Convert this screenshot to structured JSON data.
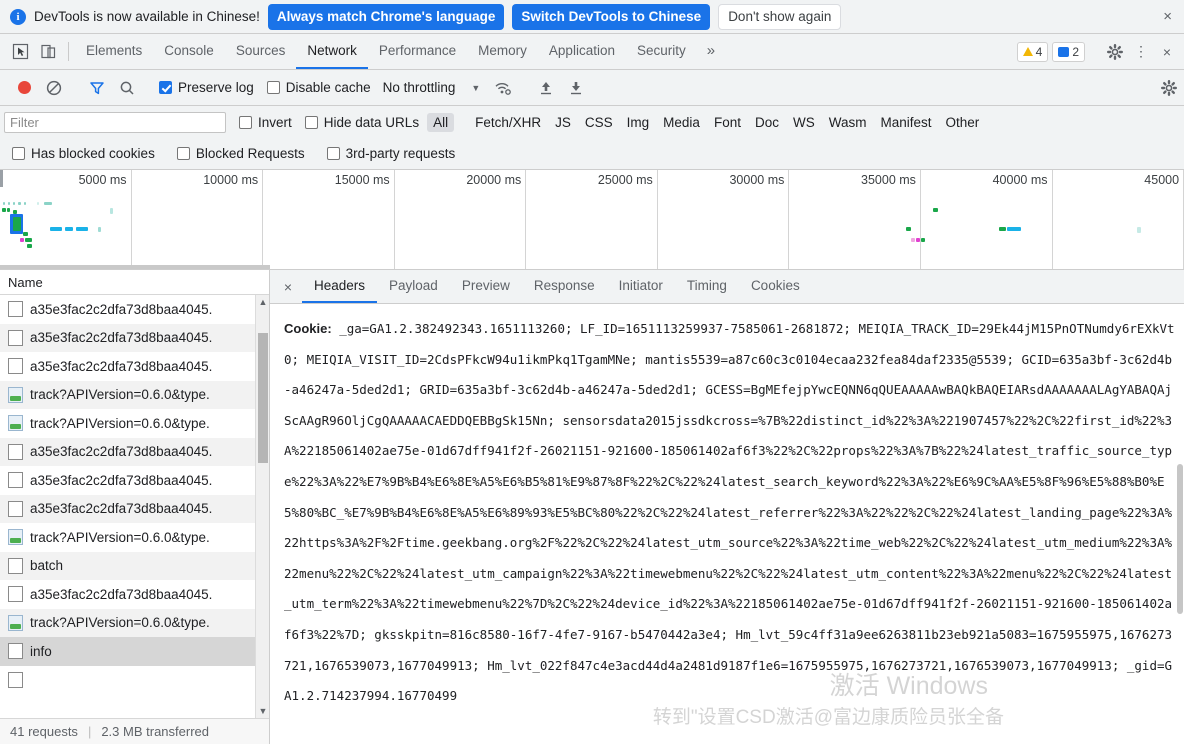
{
  "banner": {
    "icon": "info-icon",
    "message": "DevTools is now available in Chinese!",
    "primary_button": "Always match Chrome's language",
    "secondary_button": "Switch DevTools to Chinese",
    "dismiss_button": "Don't show again",
    "close_icon": "×",
    "accent_color": "#1a73e8"
  },
  "tabbar": {
    "inspect_icon": "inspect-cursor-icon",
    "device_icon": "device-toolbar-icon",
    "tabs": [
      {
        "label": "Elements",
        "active": false
      },
      {
        "label": "Console",
        "active": false
      },
      {
        "label": "Sources",
        "active": false
      },
      {
        "label": "Network",
        "active": true
      },
      {
        "label": "Performance",
        "active": false
      },
      {
        "label": "Memory",
        "active": false
      },
      {
        "label": "Application",
        "active": false
      },
      {
        "label": "Security",
        "active": false
      }
    ],
    "more_tabs_icon": "»",
    "warning_count": "4",
    "message_count": "2",
    "settings_icon": "gear-icon",
    "kebab_icon": "⋮",
    "close_icon": "×"
  },
  "netbar": {
    "record_label": "record-button",
    "clear_label": "clear-button",
    "filter_icon": "funnel-icon",
    "search_icon": "search-icon",
    "preserve_log_label": "Preserve log",
    "preserve_log_checked": true,
    "disable_cache_label": "Disable cache",
    "disable_cache_checked": false,
    "throttling_value": "No throttling",
    "throttle_caret": "▼",
    "wifi_icon": "network-conditions-icon",
    "import_icon": "import-har-icon",
    "export_icon": "export-har-icon",
    "settings_icon": "gear-icon"
  },
  "filterbar": {
    "placeholder": "Filter",
    "value": "",
    "invert_label": "Invert",
    "invert_checked": false,
    "hide_data_urls_label": "Hide data URLs",
    "hide_data_urls_checked": false,
    "types": [
      {
        "label": "All",
        "selected": true
      },
      {
        "label": "Fetch/XHR",
        "selected": false
      },
      {
        "label": "JS",
        "selected": false
      },
      {
        "label": "CSS",
        "selected": false
      },
      {
        "label": "Img",
        "selected": false
      },
      {
        "label": "Media",
        "selected": false
      },
      {
        "label": "Font",
        "selected": false
      },
      {
        "label": "Doc",
        "selected": false
      },
      {
        "label": "WS",
        "selected": false
      },
      {
        "label": "Wasm",
        "selected": false
      },
      {
        "label": "Manifest",
        "selected": false
      },
      {
        "label": "Other",
        "selected": false
      }
    ]
  },
  "blockedbar": {
    "has_blocked_cookies_label": "Has blocked cookies",
    "has_blocked_cookies_checked": false,
    "blocked_requests_label": "Blocked Requests",
    "blocked_requests_checked": false,
    "third_party_label": "3rd-party requests",
    "third_party_checked": false
  },
  "overview": {
    "ticks": [
      "5000 ms",
      "10000 ms",
      "15000 ms",
      "20000 ms",
      "25000 ms",
      "30000 ms",
      "35000 ms",
      "40000 ms",
      "45000"
    ]
  },
  "requests": {
    "column_header": "Name",
    "rows": [
      {
        "name": "a35e3fac2c2dfa73d8baa4045.",
        "icon": "document-icon",
        "selected": false
      },
      {
        "name": "a35e3fac2c2dfa73d8baa4045.",
        "icon": "document-icon",
        "selected": false
      },
      {
        "name": "a35e3fac2c2dfa73d8baa4045.",
        "icon": "document-icon",
        "selected": false
      },
      {
        "name": "track?APIVersion=0.6.0&type.",
        "icon": "image-icon",
        "selected": false
      },
      {
        "name": "track?APIVersion=0.6.0&type.",
        "icon": "image-icon",
        "selected": false
      },
      {
        "name": "a35e3fac2c2dfa73d8baa4045.",
        "icon": "document-icon",
        "selected": false
      },
      {
        "name": "a35e3fac2c2dfa73d8baa4045.",
        "icon": "document-icon",
        "selected": false
      },
      {
        "name": "a35e3fac2c2dfa73d8baa4045.",
        "icon": "document-icon",
        "selected": false
      },
      {
        "name": "track?APIVersion=0.6.0&type.",
        "icon": "image-icon",
        "selected": false
      },
      {
        "name": "batch",
        "icon": "document-icon",
        "selected": false
      },
      {
        "name": "a35e3fac2c2dfa73d8baa4045.",
        "icon": "document-icon",
        "selected": false
      },
      {
        "name": "track?APIVersion=0.6.0&type.",
        "icon": "image-icon",
        "selected": false
      },
      {
        "name": "info",
        "icon": "document-icon",
        "selected": true
      }
    ],
    "footer_requests": "41 requests",
    "footer_transferred": "2.3 MB transferred"
  },
  "detail": {
    "close_icon": "×",
    "tabs": [
      {
        "label": "Headers",
        "active": true
      },
      {
        "label": "Payload",
        "active": false
      },
      {
        "label": "Preview",
        "active": false
      },
      {
        "label": "Response",
        "active": false
      },
      {
        "label": "Initiator",
        "active": false
      },
      {
        "label": "Timing",
        "active": false
      },
      {
        "label": "Cookies",
        "active": false
      }
    ],
    "cookie_label": "Cookie:",
    "cookie_value": " _ga=GA1.2.382492343.1651113260; LF_ID=1651113259937-7585061-2681872; MEIQIA_TRACK_ID=29Ek44jM15PnOTNumdy6rEXkVt0; MEIQIA_VISIT_ID=2CdsPFkcW94u1ikmPkq1TgamMNe; mantis5539=a87c60c3c0104ecaa232fea84daf2335@5539; GCID=635a3bf-3c62d4b-a46247a-5ded2d1; GRID=635a3bf-3c62d4b-a46247a-5ded2d1; GCESS=BgMEfejpYwcEQNN6qQUEAAAAAwBAQkBAQEIARsdAAAAAAALAgYABAQAjScAAgR96OljCgQAAAAACAEDDQEBBgSk15Nn; sensorsdata2015jssdkcross=%7B%22distinct_id%22%3A%221907457%22%2C%22first_id%22%3A%22185061402ae75e-01d67dff941f2f-26021151-921600-185061402af6f3%22%2C%22props%22%3A%7B%22%24latest_traffic_source_type%22%3A%22%E7%9B%B4%E6%8E%A5%E6%B5%81%E9%87%8F%22%2C%22%24latest_search_keyword%22%3A%22%E6%9C%AA%E5%8F%96%E5%88%B0%E5%80%BC_%E7%9B%B4%E6%8E%A5%E6%89%93%E5%BC%80%22%2C%22%24latest_referrer%22%3A%22%22%2C%22%24latest_landing_page%22%3A%22https%3A%2F%2Ftime.geekbang.org%2F%22%2C%22%24latest_utm_source%22%3A%22time_web%22%2C%22%24latest_utm_medium%22%3A%22menu%22%2C%22%24latest_utm_campaign%22%3A%22timewebmenu%22%2C%22%24latest_utm_content%22%3A%22menu%22%2C%22%24latest_utm_term%22%3A%22timewebmenu%22%7D%2C%22%24device_id%22%3A%22185061402ae75e-01d67dff941f2f-26021151-921600-185061402af6f3%22%7D; gksskpitn=816c8580-16f7-4fe7-9167-b5470442a3e4; Hm_lvt_59c4ff31a9ee6263811b23eb921a5083=1675955975,1676273721,1676539073,1677049913; Hm_lvt_022f847c4e3acd44d4a2481d9187f1e6=1675955975,1676273721,1676539073,1677049913; _gid=GA1.2.714237994.16770499",
    "watermark_line1": "激活 Windows",
    "watermark_line2": "转到\"设置CSD激活@富边康质险员张全备"
  }
}
